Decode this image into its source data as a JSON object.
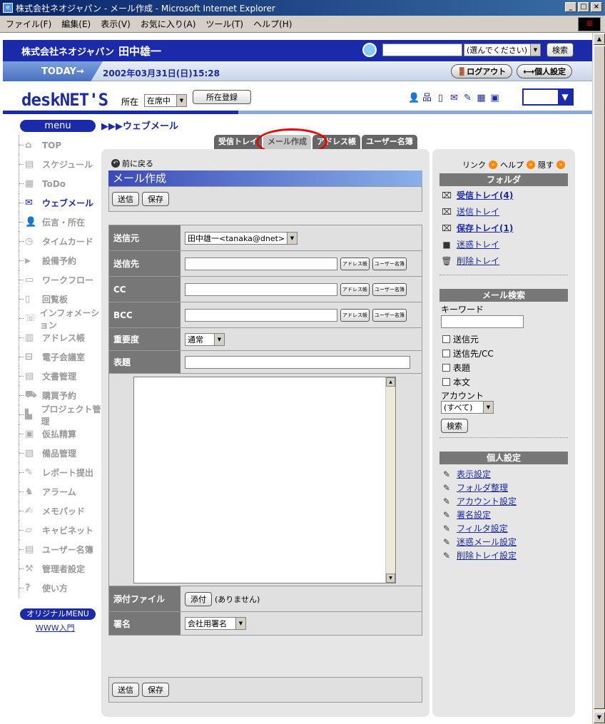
{
  "window": {
    "title": "株式会社ネオジャパン - メール作成 - Microsoft Internet Explorer"
  },
  "menubar": [
    "ファイル(F)",
    "編集(E)",
    "表示(V)",
    "お気に入り(A)",
    "ツール(T)",
    "ヘルプ(H)"
  ],
  "header": {
    "company": "株式会社ネオジャパン",
    "user": "田中雄一",
    "search_select": "(選んでください)",
    "search_button": "検索"
  },
  "todaybar": {
    "today": "TODAY→",
    "datetime": "2002年03月31日(日)15:28",
    "logout": "ログアウト",
    "personal": "個人設定"
  },
  "brand": {
    "logo_a": "desk",
    "logo_b": "NET'S",
    "location_label": "所在",
    "location_value": "在席中",
    "location_button": "所在登録"
  },
  "nav": {
    "menu": "menu",
    "breadcrumb": "▶▶▶ウェブメール",
    "items": [
      {
        "label": "TOP",
        "icon": "home-icon"
      },
      {
        "label": "スケジュール",
        "icon": "schedule-icon"
      },
      {
        "label": "ToDo",
        "icon": "todo-icon"
      },
      {
        "label": "ウェブメール",
        "icon": "mail-icon"
      },
      {
        "label": "伝言・所在",
        "icon": "person-icon"
      },
      {
        "label": "タイムカード",
        "icon": "clock-icon"
      },
      {
        "label": "設備予約",
        "icon": "facility-icon"
      },
      {
        "label": "ワークフロー",
        "icon": "workflow-icon"
      },
      {
        "label": "回覧板",
        "icon": "board-icon"
      },
      {
        "label": "インフォメーション",
        "icon": "info-icon"
      },
      {
        "label": "アドレス帳",
        "icon": "address-icon"
      },
      {
        "label": "電子会議室",
        "icon": "meeting-icon"
      },
      {
        "label": "文書管理",
        "icon": "document-icon"
      },
      {
        "label": "購買予約",
        "icon": "cart-icon"
      },
      {
        "label": "プロジェクト管理",
        "icon": "project-icon"
      },
      {
        "label": "仮払精算",
        "icon": "payment-icon"
      },
      {
        "label": "備品管理",
        "icon": "equipment-icon"
      },
      {
        "label": "レポート提出",
        "icon": "report-icon"
      },
      {
        "label": "アラーム",
        "icon": "alarm-icon"
      },
      {
        "label": "メモパッド",
        "icon": "memo-icon"
      },
      {
        "label": "キャビネット",
        "icon": "cabinet-icon"
      },
      {
        "label": "ユーザー名簿",
        "icon": "users-icon"
      },
      {
        "label": "管理者設定",
        "icon": "admin-icon"
      },
      {
        "label": "使い方",
        "icon": "help-icon"
      }
    ],
    "original_menu": "オリジナルMENU",
    "www_link": "WWW入門"
  },
  "tabs": [
    "受信トレイ",
    "メール作成",
    "アドレス帳",
    "ユーザー名簿"
  ],
  "main": {
    "back": "前に戻る",
    "title": "メール作成",
    "send": "送信",
    "save": "保存",
    "fields": {
      "from_label": "送信元",
      "from_value": "田中雄一<tanaka@dnet>",
      "to_label": "送信先",
      "cc_label": "CC",
      "bcc_label": "BCC",
      "address_btn": "アドレス帳",
      "user_btn": "ユーザー名簿",
      "priority_label": "重要度",
      "priority_value": "通常",
      "subject_label": "表題",
      "attach_label": "添付ファイル",
      "attach_button": "添付",
      "attach_none": "(ありません)",
      "signature_label": "署名",
      "signature_value": "会社用署名"
    }
  },
  "right": {
    "link": "リンク",
    "help": "ヘルプ",
    "hide": "隠す",
    "folder_head": "フォルダ",
    "folders": [
      "受信トレイ(4)",
      "送信トレイ",
      "保存トレイ(1)",
      "迷惑トレイ",
      "削除トレイ"
    ],
    "search_head": "メール検索",
    "keyword": "キーワード",
    "checks": [
      "送信元",
      "送信先/CC",
      "表題",
      "本文"
    ],
    "account": "アカウント",
    "account_value": "(すべて)",
    "search_button": "検索",
    "personal_head": "個人設定",
    "settings": [
      "表示設定",
      "フォルダ整理",
      "アカウント設定",
      "署名設定",
      "フィルタ設定",
      "迷惑メール設定",
      "削除トレイ設定"
    ]
  }
}
